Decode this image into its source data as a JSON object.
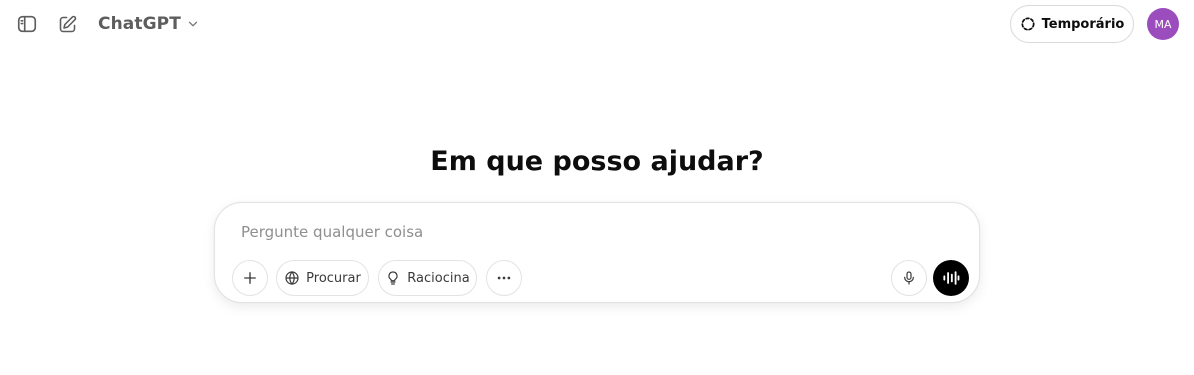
{
  "header": {
    "model_name": "ChatGPT",
    "temporary_label": "Temporário",
    "avatar_initials": "MA",
    "avatar_color": "#9b4dbd"
  },
  "icons": {
    "sidebar_toggle": "sidebar-icon",
    "new_chat": "edit-icon",
    "model_dropdown": "chevron-down-icon",
    "temporary": "dashed-circle-icon",
    "add": "plus-icon",
    "search": "globe-icon",
    "reason": "lightbulb-icon",
    "more": "ellipsis-icon",
    "dictate": "microphone-icon",
    "voice": "waveform-icon"
  },
  "main": {
    "headline": "Em que posso ajudar?"
  },
  "composer": {
    "placeholder": "Pergunte qualquer coisa",
    "value": "",
    "search_label": "Procurar",
    "reason_label": "Raciocina"
  }
}
